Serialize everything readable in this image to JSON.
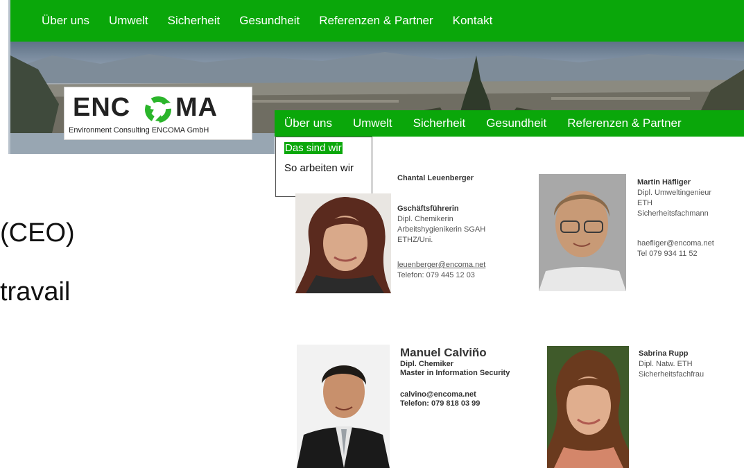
{
  "back_nav": {
    "items": [
      "Über uns",
      "Umwelt",
      "Sicherheit",
      "Gesundheit",
      "Referenzen & Partner",
      "Kontakt"
    ]
  },
  "logo": {
    "word_left": "ENC",
    "word_right": "MA",
    "tagline": "Environment  Consulting  ENCOMA GmbH"
  },
  "slide_text": {
    "line1": "(CEO)",
    "line2": "travail"
  },
  "front_nav": {
    "items": [
      "Über uns",
      "Umwelt",
      "Sicherheit",
      "Gesundheit",
      "Referenzen & Partner"
    ]
  },
  "dropdown": {
    "items": [
      "Das sind wir",
      "So arbeiten wir"
    ]
  },
  "team": {
    "chantal": {
      "name": "Chantal Leuenberger",
      "role": "Gschäftsführerin",
      "title1": "Dipl. Chemikerin",
      "title2": "Arbeitshygienikerin SGAH",
      "title3": "ETHZ/Uni.",
      "email": "leuenberger@encoma.net",
      "phone": "Telefon: 079 445 12 03"
    },
    "martin": {
      "name": "Martin Häfliger",
      "title1": "Dipl. Umweltingenieur",
      "title2": "ETH",
      "title3": "Sicherheitsfachmann",
      "email": "haefliger@encoma.net",
      "phone": "Tel 079 934 11 52"
    },
    "manuel": {
      "name": "Manuel Calviño",
      "title1": "Dipl. Chemiker",
      "title2": "Master in Information Security",
      "email": "calvino@encoma.net",
      "phone": "Telefon: 079 818 03 99"
    },
    "sabrina": {
      "name": "Sabrina Rupp",
      "title1": "Dipl. Natw. ETH",
      "title2": "Sicherheitsfachfrau"
    }
  },
  "colors": {
    "nav_green": "#0aa70a",
    "logo_arrows": "#2bb52b"
  }
}
